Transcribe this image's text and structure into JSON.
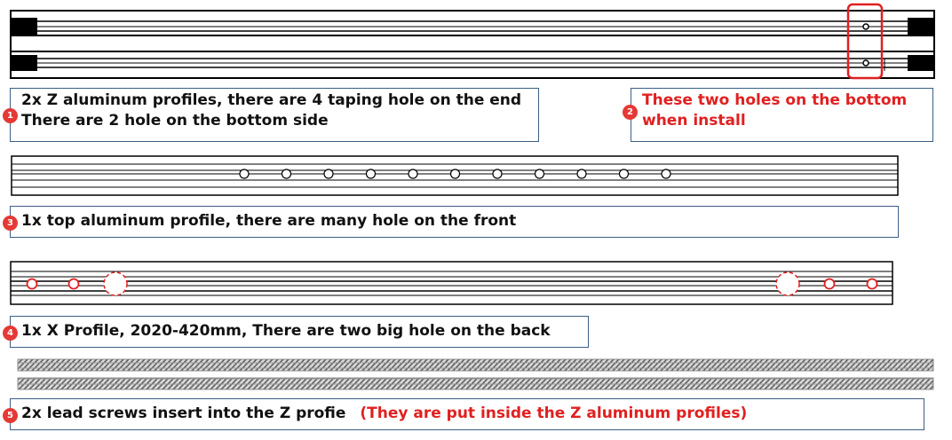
{
  "items": [
    {
      "number": "1",
      "lines": [
        "2x Z aluminum profiles, there are 4 taping hole on the end",
        "There are 2 hole on the bottom side"
      ]
    },
    {
      "number": "2",
      "lines": [
        "These two holes on the bottom",
        "when install"
      ]
    },
    {
      "number": "3",
      "lines": [
        "1x top aluminum profile, there are many hole on the front"
      ]
    },
    {
      "number": "4",
      "lines": [
        "1x X Profile, 2020-420mm, There are two big hole on the back"
      ]
    },
    {
      "number": "5",
      "text": "2x lead screws insert into the Z profie",
      "note": "(They are put inside the Z aluminum profiles)"
    }
  ],
  "colors": {
    "highlight": "#e02020",
    "box_border": "#3b5f86",
    "badge": "#e53935"
  }
}
